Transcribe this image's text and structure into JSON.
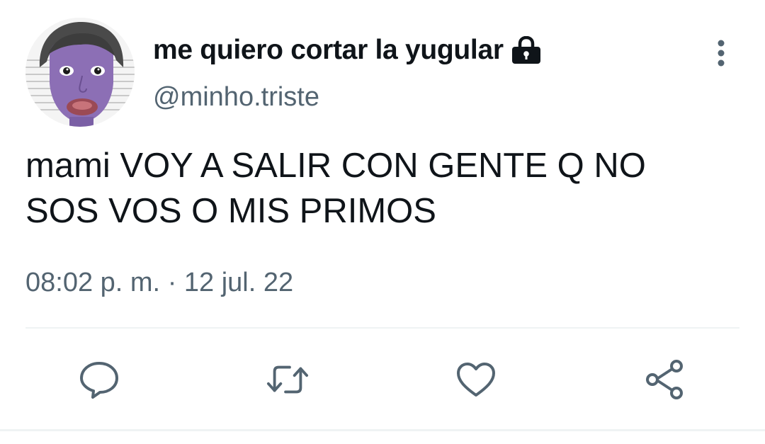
{
  "tweet": {
    "display_name": "me quiero cortar la yugular",
    "handle": "@minho.triste",
    "text": "mami VOY A SALIR CON GENTE Q NO\nSOS VOS O MIS PRIMOS",
    "time": "08:02 p. m.",
    "separator": "·",
    "date": "12 jul. 22",
    "protected": true
  },
  "icons": {
    "lock": "lock-icon",
    "more": "more-vertical-icon",
    "reply": "comment-icon",
    "retweet": "retweet-icon",
    "like": "heart-icon",
    "share": "share-icon"
  },
  "colors": {
    "text": "#0f1419",
    "secondary": "#536471",
    "divider": "#eff3f4"
  }
}
